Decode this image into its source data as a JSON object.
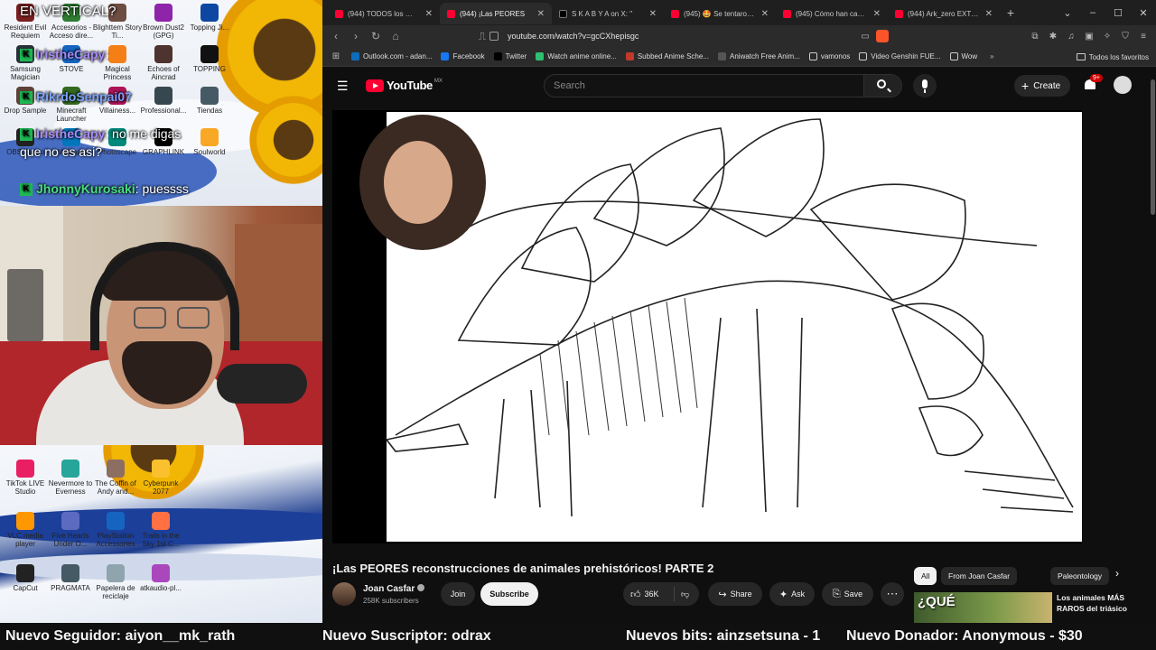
{
  "overlay": {
    "question_text": "EN VERTICAL?",
    "chat": [
      {
        "user": "IristheCapy",
        "text": ":"
      },
      {
        "user": "RikrdoSenpai07",
        "text": ""
      },
      {
        "user": "IristheCapy",
        "text": ": no me digas"
      },
      {
        "user": "",
        "text": "que no es asi?"
      },
      {
        "user": "JhonnyKurosaki",
        "text": ": puessss"
      }
    ],
    "desktop_icons_top": [
      {
        "label": "Resident Evil Requiem"
      },
      {
        "label": "Accesorios - Acceso dire..."
      },
      {
        "label": "Blighttem Story Ti..."
      },
      {
        "label": "Brown Dust2 (GPG)"
      },
      {
        "label": "Topping Ji..."
      },
      {
        "label": "Samsung Magician"
      },
      {
        "label": "STOVE"
      },
      {
        "label": "Magical Princess"
      },
      {
        "label": "Echoes of Aincrad"
      },
      {
        "label": "TOPPING"
      },
      {
        "label": "Drop Sample"
      },
      {
        "label": "Minecraft Launcher"
      },
      {
        "label": "Villainess..."
      },
      {
        "label": "Professional..."
      },
      {
        "label": "Tiendas"
      },
      {
        "label": "OBS Studio"
      },
      {
        "label": "Wallpaper"
      },
      {
        "label": "Photoscape"
      },
      {
        "label": "GRAPHLINK"
      },
      {
        "label": "Soulworld"
      }
    ],
    "desktop_icons_bottom": [
      {
        "label": "TikTok LIVE Studio"
      },
      {
        "label": "Nevermore to Everness"
      },
      {
        "label": "The Coffin of Andy and..."
      },
      {
        "label": "Cyberpunk 2077"
      },
      {
        "label": "VLC media player"
      },
      {
        "label": "Five Hearts Under O..."
      },
      {
        "label": "PlayStation Accessories"
      },
      {
        "label": "Trails in the Sky 1st C..."
      },
      {
        "label": "CapCut"
      },
      {
        "label": "PRAGMATA"
      },
      {
        "label": "Papelera de reciclaje"
      },
      {
        "label": "atkaudio-pl..."
      }
    ]
  },
  "browser": {
    "tabs": [
      {
        "label": "(944) TODOS los 🔗 VIDEOS",
        "active": false,
        "icon": "youtube"
      },
      {
        "label": "(944) ¡Las PEORES",
        "active": true,
        "icon": "youtube"
      },
      {
        "label": "S K A B Y A on X: \"",
        "active": false,
        "icon": "x"
      },
      {
        "label": "(945) 🤩 Se tentaron en p",
        "active": false,
        "icon": "youtube"
      },
      {
        "label": "(945) Cómo han cambiado",
        "active": false,
        "icon": "youtube"
      },
      {
        "label": "(944) Ark_zero EXTRA - Yo",
        "active": false,
        "icon": "youtube"
      }
    ],
    "url": "youtube.com/watch?v=gcCXhepisgc",
    "bookmarks": [
      {
        "label": "Outlook.com - adan...",
        "color": "#0f6cbd"
      },
      {
        "label": "Facebook",
        "color": "#1877f2"
      },
      {
        "label": "Twitter",
        "color": "#000000"
      },
      {
        "label": "Watch anime online...",
        "color": "#2fbf71"
      },
      {
        "label": "Subbed Anime Sche...",
        "color": "#c0392b"
      },
      {
        "label": "Aniwatch Free Anim...",
        "color": "#555555"
      },
      {
        "label": "vamonos",
        "color": "folder"
      },
      {
        "label": "Video Genshin FUE...",
        "color": "folder"
      },
      {
        "label": "Wow",
        "color": "folder"
      }
    ],
    "bookmarks_more": "»",
    "bookmarks_all": "Todos los favoritos"
  },
  "youtube": {
    "logo": "YouTube",
    "country_code": "MX",
    "search_placeholder": "Search",
    "create_label": "Create",
    "notifications": "9+",
    "video_title": "¡Las PEORES reconstrucciones de animales prehistóricos! PARTE 2",
    "channel_name": "Joan Casfar",
    "subscribers": "258K subscribers",
    "join_label": "Join",
    "subscribe_label": "Subscribe",
    "likes": "36K",
    "share_label": "Share",
    "ask_label": "Ask",
    "save_label": "Save",
    "chips": [
      "All",
      "From Joan Casfar",
      "Paleontology"
    ],
    "rec_thumb_text": "¿QUÉ",
    "rec_title": "Los animales MÁS RAROS del triásico"
  },
  "ticker": {
    "follower": "Nuevo Seguidor: aiyon__mk_rath",
    "subscriber": "Nuevo Suscriptor: odrax",
    "bits": "Nuevos bits: ainzsetsuna - 1",
    "donor": "Nuevo Donador: Anonymous - $30"
  },
  "colors": {
    "yt_red": "#ff0033",
    "badge_green": "#1db954",
    "chair_red": "#b0262a"
  }
}
